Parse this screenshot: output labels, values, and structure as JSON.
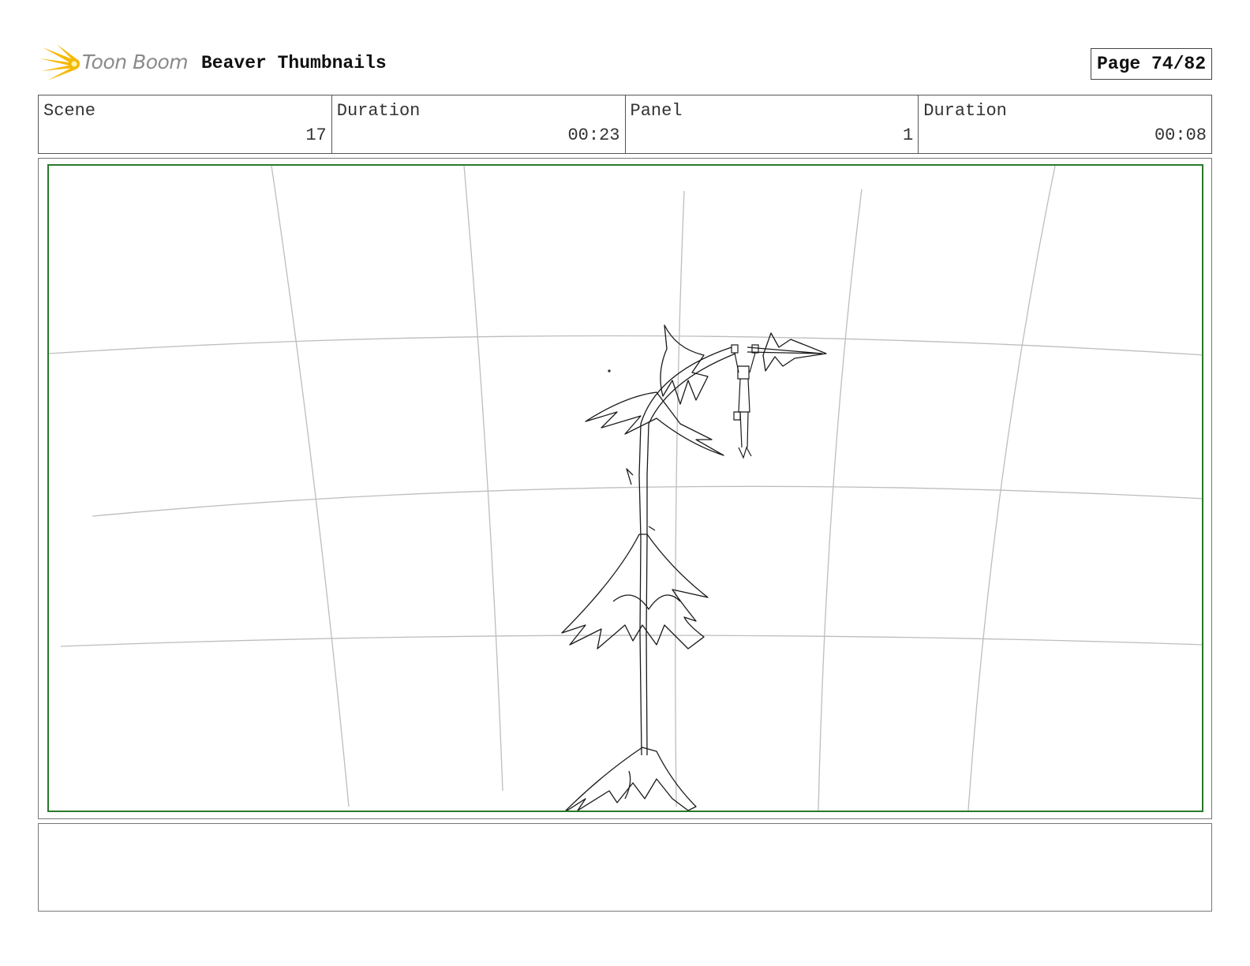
{
  "header": {
    "logo_text": "Toon Boom",
    "title": "Beaver Thumbnails",
    "page_label": "Page 74/82"
  },
  "info": [
    {
      "label": "Scene",
      "value": "17"
    },
    {
      "label": "Duration",
      "value": "00:23"
    },
    {
      "label": "Panel",
      "value": "1"
    },
    {
      "label": "Duration",
      "value": "00:08"
    }
  ],
  "panel": {
    "frame_color": "#2a7a2a",
    "icons": [
      "sketch-tree-icon",
      "hanging-figure-icon"
    ]
  },
  "notes": {
    "text": ""
  },
  "colors": {
    "logo_flame": "#f5b800",
    "logo_text": "#8a8a8a",
    "frame_green": "#2a7a2a"
  }
}
